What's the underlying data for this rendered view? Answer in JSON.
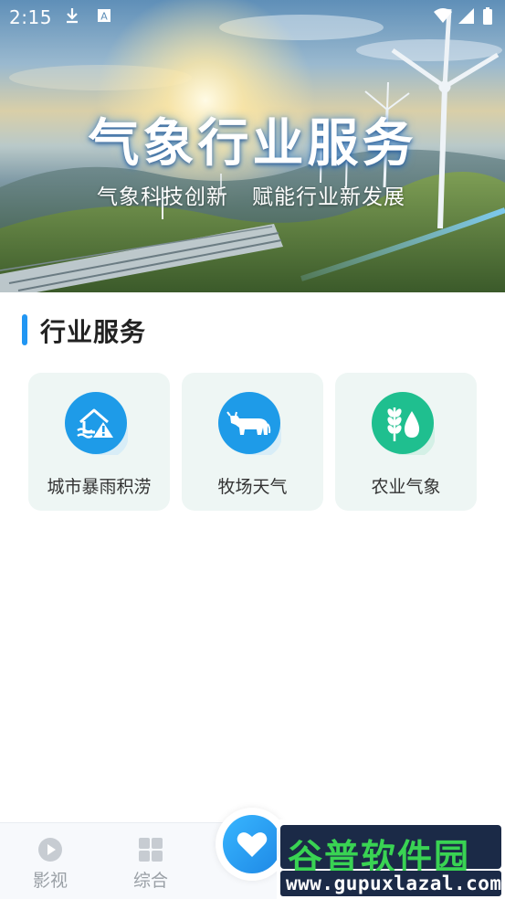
{
  "status_bar": {
    "time": "2:15",
    "left_icons": [
      "download-icon",
      "font-a-icon"
    ],
    "right_icons": [
      "wifi-icon",
      "signal-icon",
      "battery-icon"
    ]
  },
  "banner": {
    "title": "气象行业服务",
    "subtitle_left": "气象科技创新",
    "subtitle_right": "赋能行业新发展"
  },
  "section": {
    "title": "行业服务",
    "accent_color": "#2196f3"
  },
  "services": [
    {
      "label": "城市暴雨积涝",
      "icon": "flood-house-icon",
      "color": "#1e9be8"
    },
    {
      "label": "牧场天气",
      "icon": "cattle-icon",
      "color": "#1e9be8"
    },
    {
      "label": "农业气象",
      "icon": "wheat-drop-icon",
      "color": "#1fbf8f"
    }
  ],
  "bottom_nav": {
    "items": [
      {
        "label": "影视",
        "icon": "play-circle-icon"
      },
      {
        "label": "综合",
        "icon": "grid-icon"
      }
    ],
    "center_icon": "heart-icon"
  },
  "watermark": {
    "text": "谷普软件园",
    "url": "www.gupuxlazal.com"
  }
}
